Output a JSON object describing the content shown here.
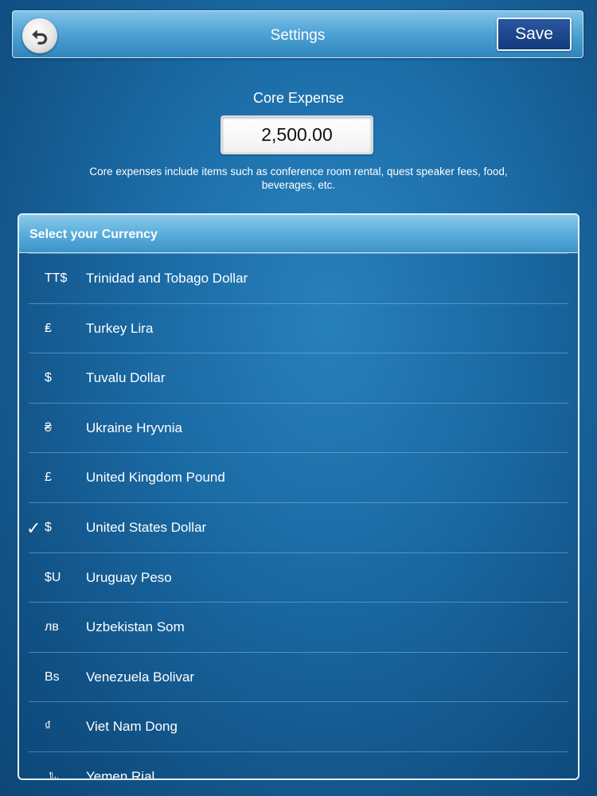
{
  "header": {
    "title": "Settings",
    "save_label": "Save",
    "back_icon": "undo-arrow-icon"
  },
  "core_expense": {
    "label": "Core Expense",
    "value": "2,500.00",
    "note": "Core expenses include items such as conference room rental, quest speaker fees, food, beverages, etc."
  },
  "currency": {
    "header": "Select your Currency",
    "selected_index": 5,
    "items": [
      {
        "symbol": "TT$",
        "name": "Trinidad and Tobago Dollar",
        "check": ""
      },
      {
        "symbol": "₤",
        "name": "Turkey Lira",
        "check": ""
      },
      {
        "symbol": "$",
        "name": "Tuvalu Dollar",
        "check": ""
      },
      {
        "symbol": "₴",
        "name": "Ukraine Hryvnia",
        "check": ""
      },
      {
        "symbol": "£",
        "name": "United Kingdom Pound",
        "check": ""
      },
      {
        "symbol": "$",
        "name": "United States Dollar",
        "check": "✓"
      },
      {
        "symbol": "$U",
        "name": "Uruguay Peso",
        "check": ""
      },
      {
        "symbol": "лв",
        "name": "Uzbekistan Som",
        "check": ""
      },
      {
        "symbol": "Bs",
        "name": "Venezuela Bolivar",
        "check": ""
      },
      {
        "symbol": "₫",
        "name": "Viet Nam Dong",
        "check": ""
      },
      {
        "symbol": "﷼",
        "name": "Yemen Rial",
        "check": ""
      }
    ]
  },
  "colors": {
    "background": "#1c6da8",
    "header_bar": "#4da1d3",
    "save_button": "#133a7c",
    "text": "#ffffff"
  }
}
